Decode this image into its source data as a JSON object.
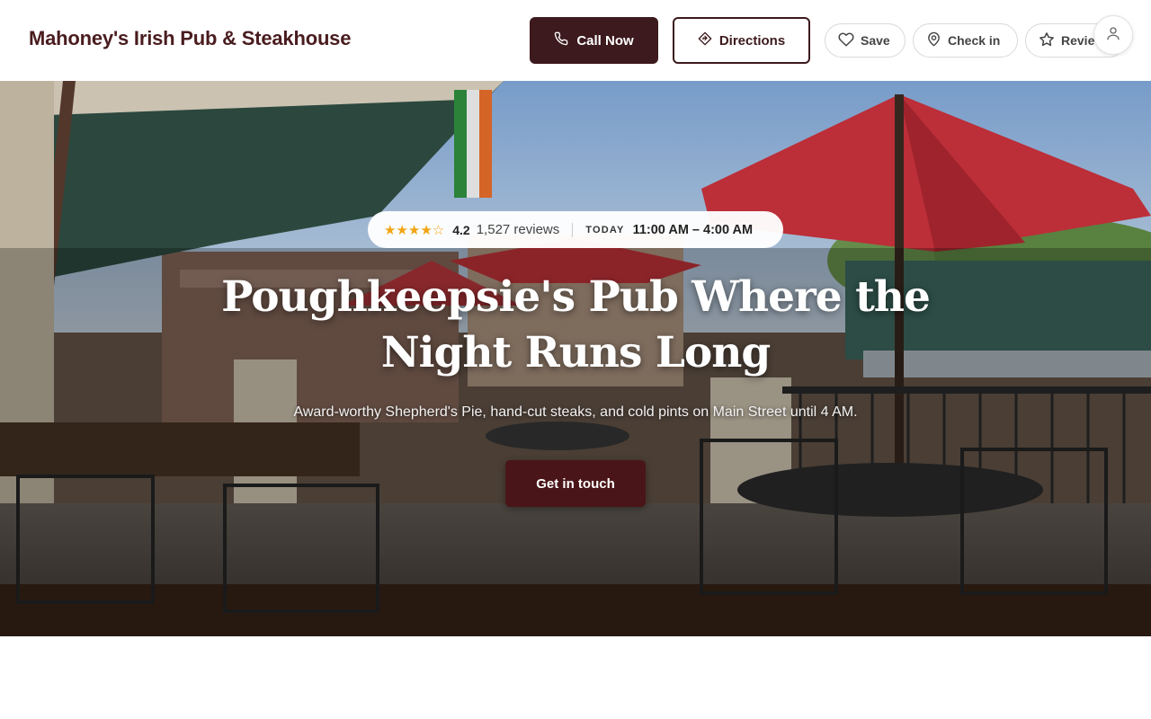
{
  "header": {
    "brand": "Mahoney's Irish Pub & Steakhouse",
    "call_label": "Call Now",
    "directions_label": "Directions",
    "save_label": "Save",
    "checkin_label": "Check in",
    "review_label": "Review"
  },
  "hero": {
    "stars": "★★★★☆",
    "rating": "4.2",
    "reviews": "1,527 reviews",
    "today_label": "TODAY",
    "hours": "11:00 AM – 4:00 AM",
    "title": "Poughkeepsie's Pub Where the Night Runs Long",
    "subtitle": "Award-worthy Shepherd's Pie, hand-cut steaks, and cold pints on Main Street until 4 AM.",
    "cta_label": "Get in touch"
  },
  "colors": {
    "brand": "#4a1c1f",
    "primary_button": "#3d1a1d",
    "cta_button": "#4a1518",
    "star": "#f2a413"
  },
  "icons": {
    "call": "phone-icon",
    "directions": "directions-icon",
    "save": "heart-icon",
    "checkin": "location-pin-icon",
    "review": "star-icon",
    "account": "user-icon"
  }
}
